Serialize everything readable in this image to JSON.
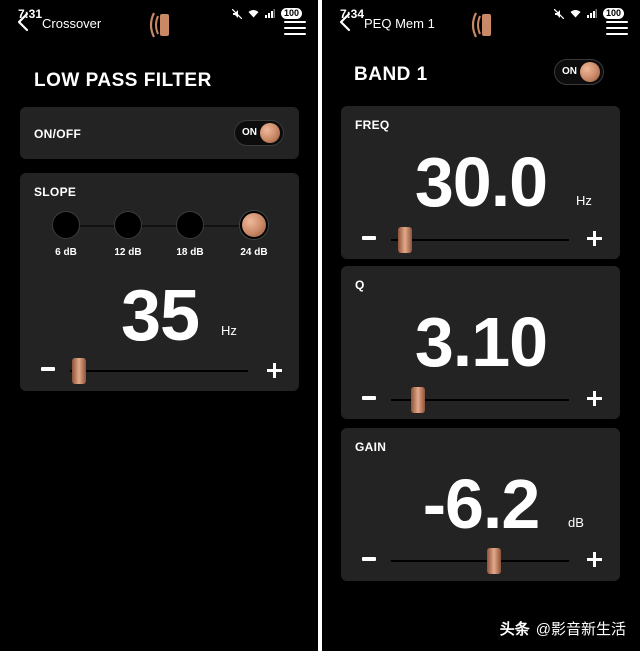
{
  "left": {
    "status": {
      "time": "7:31",
      "battery": "100"
    },
    "nav_title": "Crossover",
    "heading": "LOW PASS FILTER",
    "onoff": {
      "label": "ON/OFF",
      "toggle_label": "ON"
    },
    "slope": {
      "label": "SLOPE",
      "options": [
        "6 dB",
        "12 dB",
        "18 dB",
        "24 dB"
      ],
      "selected_index": 3
    },
    "frequency": {
      "value": "35",
      "unit": "Hz",
      "slider_fraction": 0.05
    }
  },
  "right": {
    "status": {
      "time": "7:34",
      "battery": "100"
    },
    "nav_title": "PEQ Mem 1",
    "heading": "BAND 1",
    "toggle_label": "ON",
    "freq": {
      "label": "FREQ",
      "value": "30.0",
      "unit": "Hz",
      "slider_fraction": 0.08
    },
    "q": {
      "label": "Q",
      "value": "3.10",
      "slider_fraction": 0.15
    },
    "gain": {
      "label": "GAIN",
      "value": "-6.2",
      "unit": "dB",
      "slider_fraction": 0.58
    }
  },
  "watermark": {
    "brand": "头条",
    "handle": "@影音新生活"
  },
  "colors": {
    "accent": "#c98866",
    "card": "#232323",
    "background": "#000000"
  }
}
